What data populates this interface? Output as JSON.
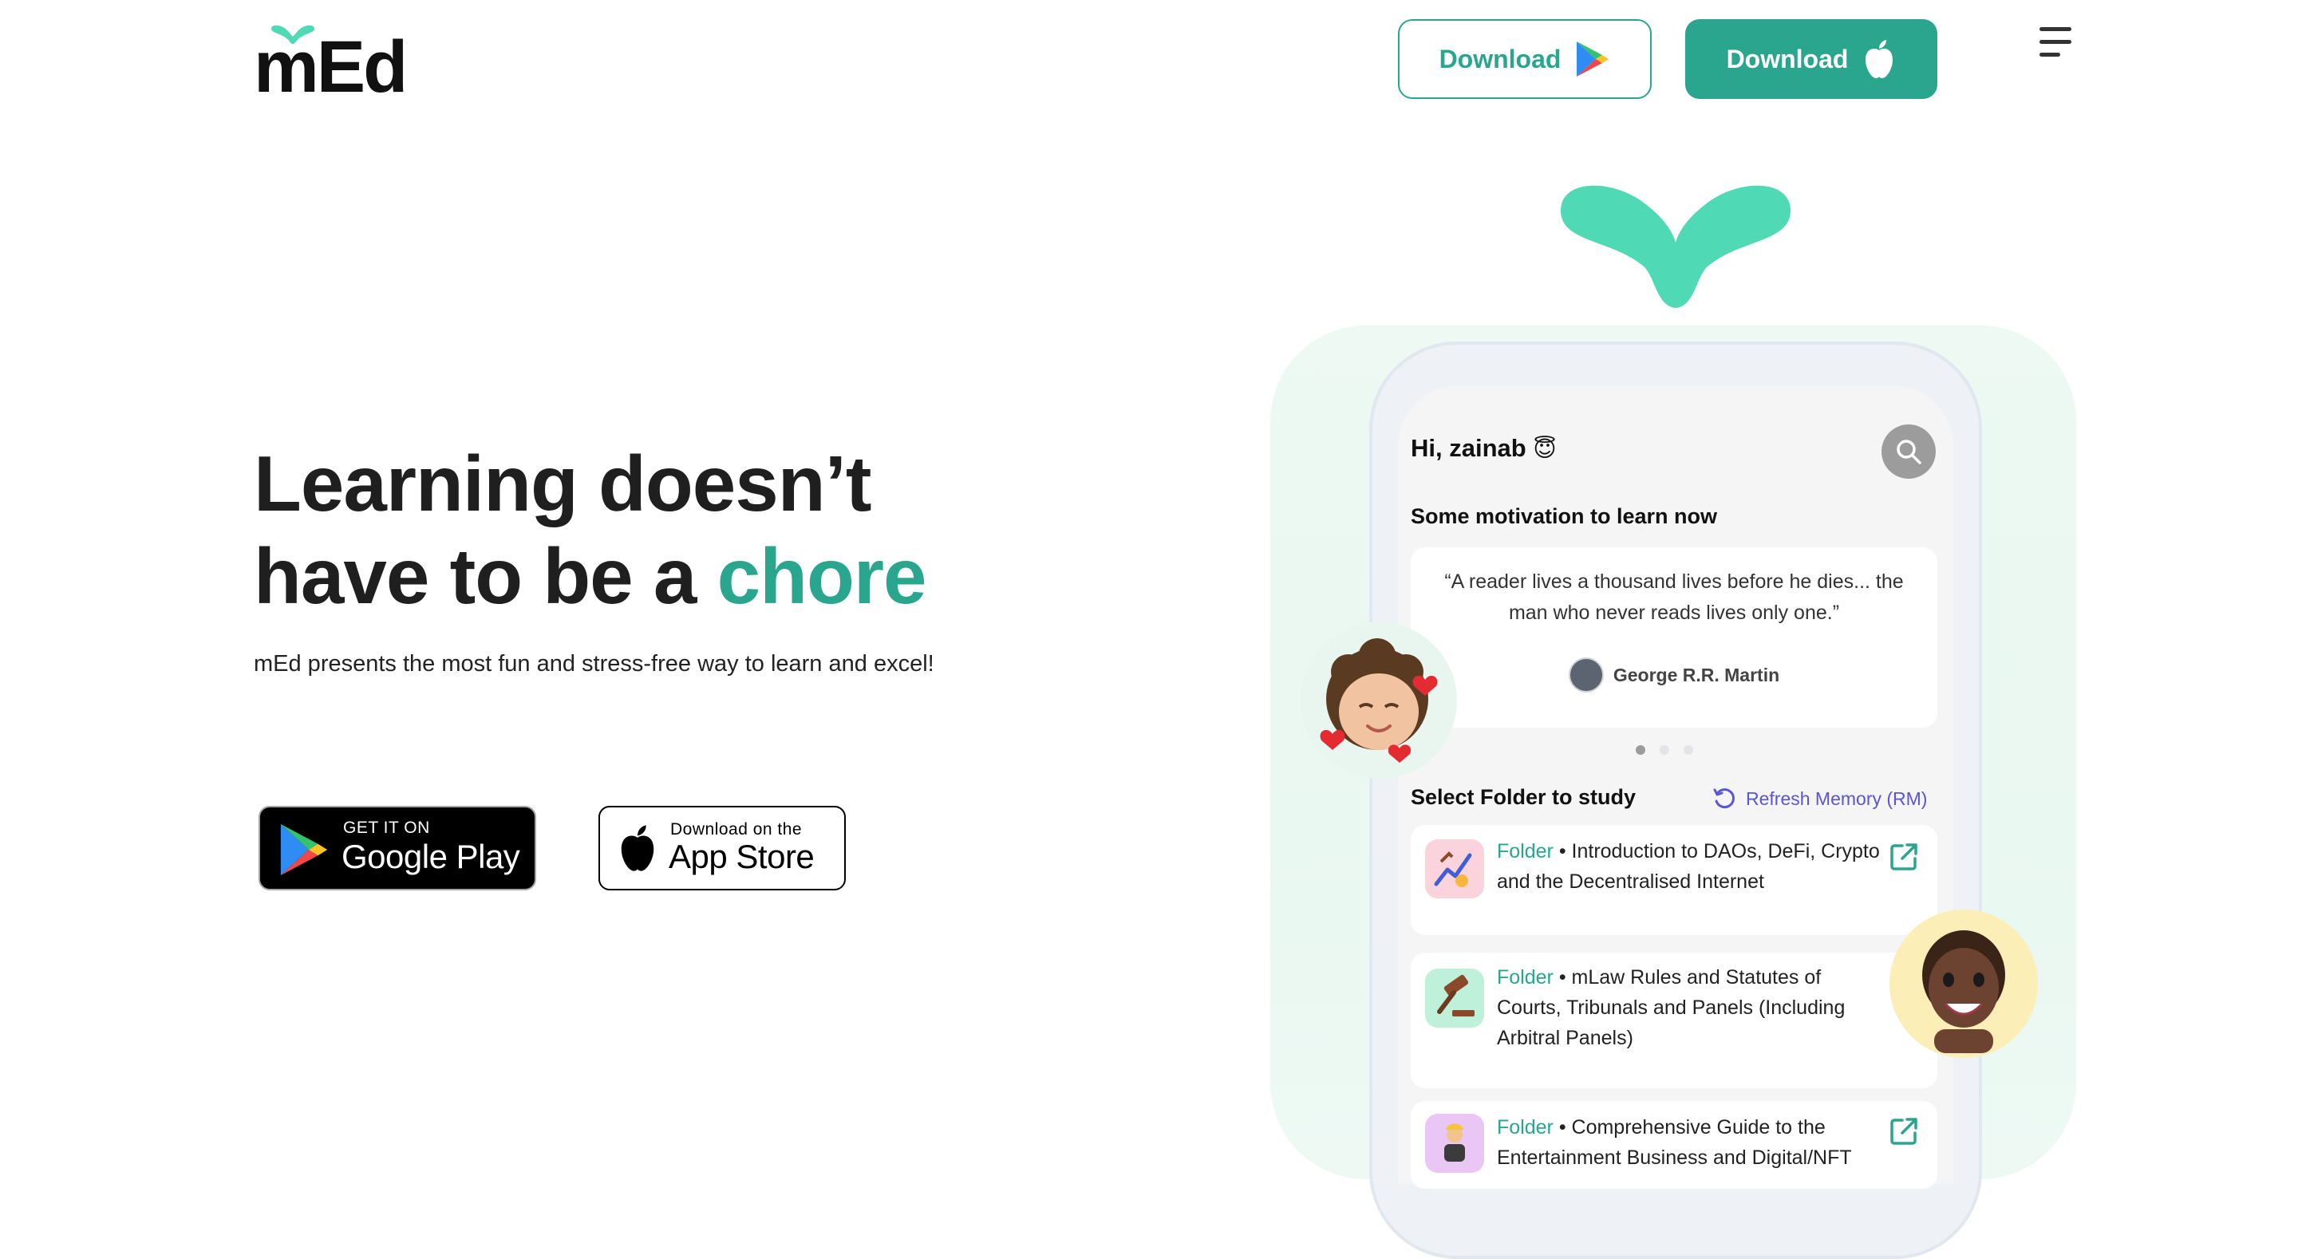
{
  "header": {
    "logo_text": "mEd",
    "download_play_label": "Download",
    "download_apple_label": "Download",
    "menu_icon": "hamburger-menu-icon"
  },
  "hero": {
    "headline_line1": "Learning doesn’t",
    "headline_line2_prefix": "have to be a ",
    "headline_accent": "chore",
    "subtext": "mEd presents the most fun and stress-free way to learn and excel!",
    "google_play_small": "GET IT ON",
    "google_play_big": "Google Play",
    "app_store_small": "Download on the",
    "app_store_big": "App Store"
  },
  "phone": {
    "greeting": "Hi, zainab",
    "greeting_emoji": "😇",
    "motivation_title": "Some motivation to learn now",
    "quote": "“A reader lives a thousand lives before he dies... the man who never reads lives only one.”",
    "quote_author": "George R.R. Martin",
    "carousel_dots": 3,
    "carousel_active": 1,
    "select_folder_title": "Select Folder to study",
    "refresh_label": "Refresh Memory (RM)",
    "folders": [
      {
        "tag": "Folder",
        "title": " • Introduction to DAOs, DeFi, Crypto and the Decentralised Internet",
        "icon": "crypto-chart-icon"
      },
      {
        "tag": "Folder",
        "title": " • mLaw Rules and Statutes of Courts, Tribunals and Panels (Including Arbitral Panels)",
        "icon": "gavel-icon"
      },
      {
        "tag": "Folder",
        "title": " • Comprehensive Guide to the Entertainment Business and Digital/NFT",
        "icon": "performer-icon"
      }
    ]
  },
  "colors": {
    "brand": "#2aa68f",
    "sprout": "#4fd9b5",
    "refresh": "#5b55d6",
    "text_dark": "#1f1f1f"
  }
}
